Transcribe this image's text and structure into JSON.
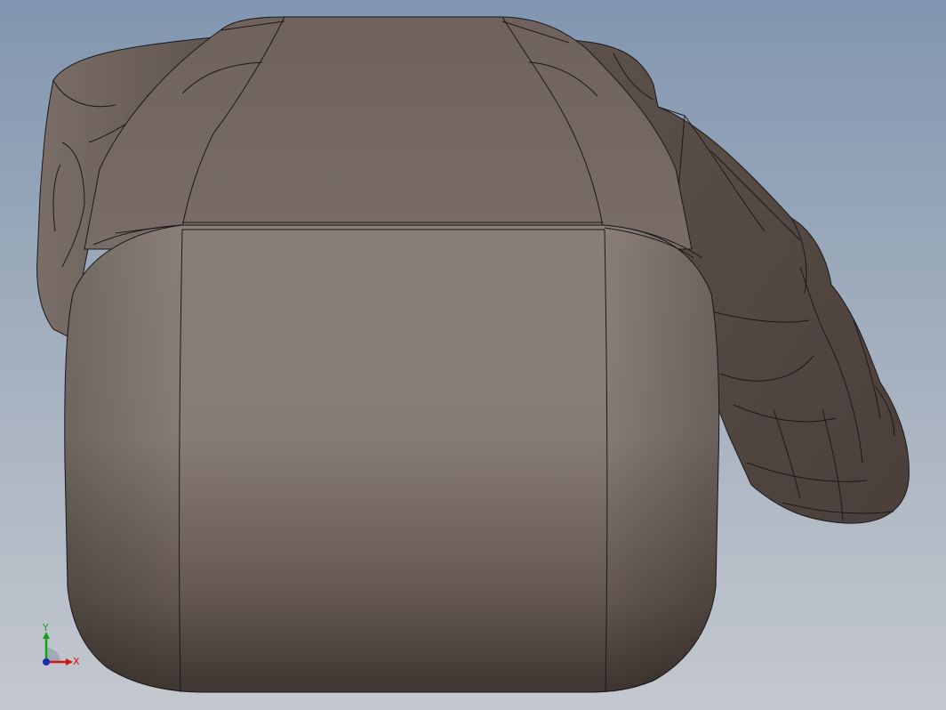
{
  "viewport": {
    "background_top": "#8196b0",
    "background_bottom": "#c4c8cf",
    "model_color": "#7d706a",
    "edge_color": "#1a1a1a"
  },
  "triad": {
    "y_label": "Y",
    "x_label": "X",
    "y_color": "#13a313",
    "x_color": "#d41414",
    "origin_color": "#1a2fb0"
  }
}
